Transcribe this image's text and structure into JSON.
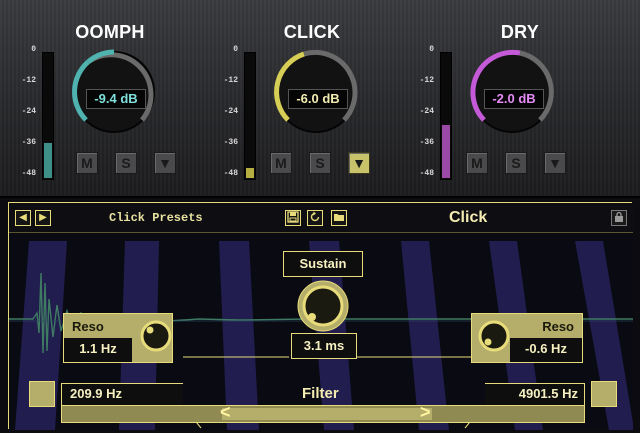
{
  "channels": [
    {
      "title": "OOMPH",
      "value": "-9.4 dB",
      "accent": "#4fb4b0",
      "level": 0.28,
      "meter_color": "#3e8f88"
    },
    {
      "title": "CLICK",
      "value": "-6.0 dB",
      "accent": "#d7cf55",
      "level": 0.08,
      "meter_color": "#b5ad40"
    },
    {
      "title": "DRY",
      "value": "-2.0 dB",
      "accent": "#c45ad8",
      "level": 0.42,
      "meter_color": "#9a4aa6"
    }
  ],
  "scale_ticks": [
    "0",
    "-12",
    "-24",
    "-36",
    "-48"
  ],
  "buttons": {
    "mute": "M",
    "solo": "S",
    "select": "▼"
  },
  "click_select_active": true,
  "header": {
    "prev": "◀",
    "next": "▶",
    "presets_label": "Click Presets",
    "save_icon": "floppy-icon",
    "reset_icon": "reset-icon",
    "folder_icon": "folder-icon",
    "mode_title": "Click",
    "lock_icon": "lock-icon"
  },
  "sustain": {
    "label": "Sustain",
    "value": "3.1 ms"
  },
  "reso_left": {
    "label": "Reso",
    "value": "1.1 Hz"
  },
  "reso_right": {
    "label": "Reso",
    "value": "-0.6 Hz"
  },
  "filter": {
    "label": "Filter",
    "low": "209.9 Hz",
    "high": "4901.5 Hz",
    "left_arrow": "<",
    "right_arrow": ">"
  },
  "accent_color": "#e8dc7a"
}
